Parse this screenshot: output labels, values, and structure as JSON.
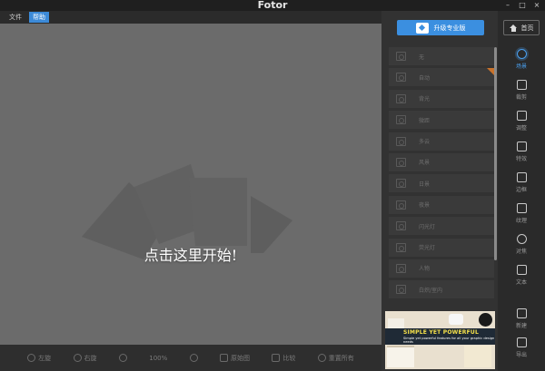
{
  "app": {
    "title": "Fotor",
    "window_buttons": [
      "–",
      "□",
      "×"
    ]
  },
  "menu": [
    {
      "label": "文件",
      "active": false
    },
    {
      "label": "帮助",
      "active": true
    }
  ],
  "canvas": {
    "prompt": "点击这里开始!"
  },
  "bottom_toolbar": {
    "items": [
      {
        "label": "左旋",
        "icon": "rotate-left-icon"
      },
      {
        "label": "右旋",
        "icon": "rotate-right-icon"
      },
      {
        "label": "",
        "icon": "zoom-out-icon"
      },
      {
        "label": "100%",
        "icon": ""
      },
      {
        "label": "",
        "icon": "zoom-in-icon"
      },
      {
        "label": "原始图",
        "icon": "original-image-icon"
      },
      {
        "label": "比较",
        "icon": "compare-icon"
      },
      {
        "label": "重置所有",
        "icon": "reset-all-icon"
      }
    ]
  },
  "panel": {
    "upgrade_label": "升级专业版",
    "effects": [
      {
        "label": "无",
        "corner": false
      },
      {
        "label": "自动",
        "corner": true
      },
      {
        "label": "背光",
        "corner": false
      },
      {
        "label": "微距",
        "corner": false
      },
      {
        "label": "多云",
        "corner": false
      },
      {
        "label": "风景",
        "corner": false
      },
      {
        "label": "日景",
        "corner": false
      },
      {
        "label": "夜景",
        "corner": false
      },
      {
        "label": "闪光灯",
        "corner": false
      },
      {
        "label": "荧光灯",
        "corner": false
      },
      {
        "label": "人物",
        "corner": false
      },
      {
        "label": "白炽/室内",
        "corner": false
      }
    ],
    "banner": {
      "headline": "SIMPLE YET POWERFUL",
      "subline": "Simple yet powerful features for all your graphic design needs",
      "small_text": "Fotor"
    }
  },
  "right_sidebar": {
    "home_label": "首页",
    "tools": [
      {
        "label": "场景",
        "icon": "sun-icon",
        "active": true
      },
      {
        "label": "裁剪",
        "icon": "crop-icon",
        "active": false
      },
      {
        "label": "调整",
        "icon": "brush-icon",
        "active": false
      },
      {
        "label": "特效",
        "icon": "magic-wand-icon",
        "active": false
      },
      {
        "label": "边框",
        "icon": "frame-icon",
        "active": false
      },
      {
        "label": "纹理",
        "icon": "texture-icon",
        "active": false
      },
      {
        "label": "对焦",
        "icon": "focus-icon",
        "active": false
      },
      {
        "label": "文本",
        "icon": "text-icon",
        "active": false
      },
      {
        "label": "新建",
        "icon": "new-file-icon",
        "active": false
      },
      {
        "label": "导出",
        "icon": "export-icon",
        "active": false
      }
    ]
  },
  "colors": {
    "accent": "#3b8fe0",
    "canvas_bg": "#6b6b6b",
    "panel_bg": "#323232",
    "sidebar_bg": "#2a2a2a",
    "corner_badge": "#c9732c"
  }
}
